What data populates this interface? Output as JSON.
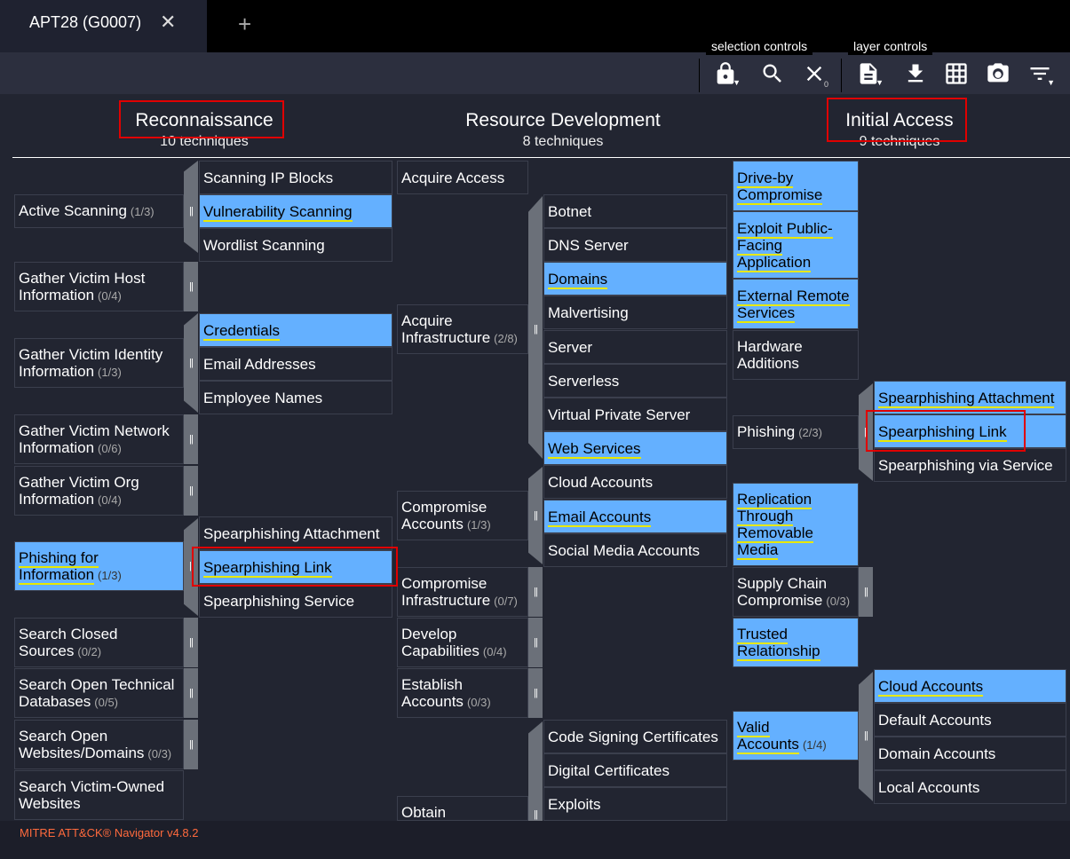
{
  "tab": {
    "title": "APT28 (G0007)",
    "close": "✕",
    "add": "+"
  },
  "toolbar": {
    "selection_label": "selection controls",
    "layer_label": "layer controls",
    "clear_count": "0"
  },
  "tactics": [
    {
      "name": "Reconnaissance",
      "count": "10 techniques"
    },
    {
      "name": "Resource Development",
      "count": "8 techniques"
    },
    {
      "name": "Initial Access",
      "count": "9 techniques"
    }
  ],
  "recon": {
    "active_scanning": {
      "name": "Active Scanning",
      "count": "(1/3)"
    },
    "gather_host": {
      "name": "Gather Victim Host Information",
      "count": "(0/4)"
    },
    "gather_identity": {
      "name": "Gather Victim Identity Information",
      "count": "(1/3)"
    },
    "gather_network": {
      "name": "Gather Victim Network Information",
      "count": "(0/6)"
    },
    "gather_org": {
      "name": "Gather Victim Org Information",
      "count": "(0/4)"
    },
    "phishing_info": {
      "name": "Phishing for Information",
      "count": "(1/3)"
    },
    "search_closed": {
      "name": "Search Closed Sources",
      "count": "(0/2)"
    },
    "search_tech_db": {
      "name": "Search Open Technical Databases",
      "count": "(0/5)"
    },
    "search_websites": {
      "name": "Search Open Websites/Domains",
      "count": "(0/3)"
    },
    "search_victim_owned": {
      "name": "Search Victim-Owned Websites"
    },
    "sub": {
      "scanning_ip": "Scanning IP Blocks",
      "vuln_scanning": "Vulnerability Scanning",
      "wordlist": "Wordlist Scanning",
      "credentials": "Credentials",
      "email_addresses": "Email Addresses",
      "employee_names": "Employee Names",
      "spear_attach": "Spearphishing Attachment",
      "spear_link": "Spearphishing Link",
      "spear_service": "Spearphishing Service"
    }
  },
  "resdev": {
    "acquire_access": {
      "name": "Acquire Access"
    },
    "acquire_infra": {
      "name": "Acquire Infrastructure",
      "count": "(2/8)"
    },
    "compromise_accounts": {
      "name": "Compromise Accounts",
      "count": "(1/3)"
    },
    "compromise_infra": {
      "name": "Compromise Infrastructure",
      "count": "(0/7)"
    },
    "develop_cap": {
      "name": "Develop Capabilities",
      "count": "(0/4)"
    },
    "establish_accounts": {
      "name": "Establish Accounts",
      "count": "(0/3)"
    },
    "obtain": {
      "name": "Obtain"
    },
    "sub": {
      "botnet": "Botnet",
      "dns_server": "DNS Server",
      "domains": "Domains",
      "malvertising": "Malvertising",
      "server": "Server",
      "serverless": "Serverless",
      "vps": "Virtual Private Server",
      "web_services": "Web Services",
      "cloud_accounts": "Cloud Accounts",
      "email_accounts": "Email Accounts",
      "social_media": "Social Media Accounts",
      "code_signing": "Code Signing Certificates",
      "digital_certs": "Digital Certificates",
      "exploits": "Exploits"
    }
  },
  "initial": {
    "drive_by": {
      "name": "Drive-by Compromise"
    },
    "exploit_public": {
      "name": "Exploit Public-Facing Application"
    },
    "external_remote": {
      "name": "External Remote Services"
    },
    "hardware_add": {
      "name": "Hardware Additions"
    },
    "phishing": {
      "name": "Phishing",
      "count": "(2/3)"
    },
    "replication": {
      "name": "Replication Through Removable Media"
    },
    "supply_chain": {
      "name": "Supply Chain Compromise",
      "count": "(0/3)"
    },
    "trusted_rel": {
      "name": "Trusted Relationship"
    },
    "valid_accounts": {
      "name": "Valid Accounts",
      "count": "(1/4)"
    },
    "sub": {
      "spear_attach": "Spearphishing Attachment",
      "spear_link": "Spearphishing Link",
      "spear_via_service": "Spearphishing via Service",
      "cloud_accounts": "Cloud Accounts",
      "default_accounts": "Default Accounts",
      "domain_accounts": "Domain Accounts",
      "local_accounts": "Local Accounts"
    }
  },
  "footer": {
    "text": "MITRE ATT&CK® Navigator v4.8.2"
  },
  "colors": {
    "highlight": "#64b0ff",
    "underline": "#e8e800",
    "annotation": "#e00000",
    "background": "#222531"
  }
}
